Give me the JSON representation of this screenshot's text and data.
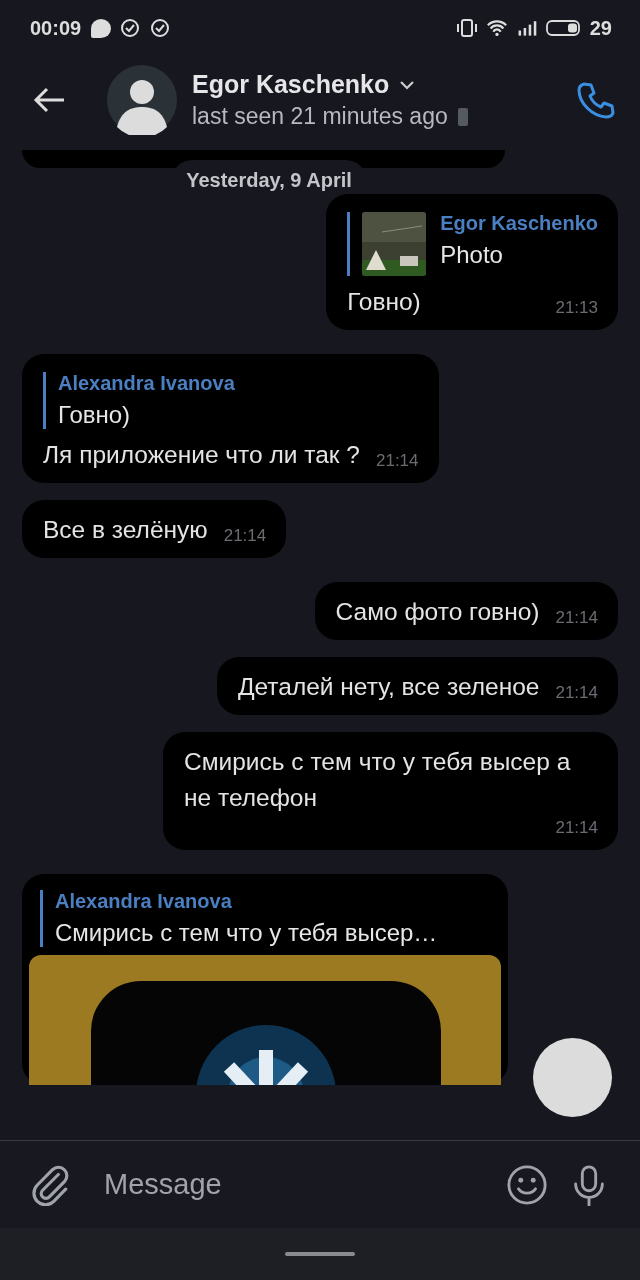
{
  "status_bar": {
    "time": "00:09",
    "battery": "29"
  },
  "header": {
    "name": "Egor Kaschenko",
    "status": "last seen 21 minutes ago"
  },
  "date_chip": "Yesterday, 9 April",
  "messages": [
    {
      "kind": "out",
      "reply": {
        "author": "Egor Kaschenko",
        "text": "Photo",
        "thumbnail": true
      },
      "text": "Говно)",
      "time": "21:13"
    },
    {
      "kind": "in",
      "reply": {
        "author": "Alexandra Ivanova",
        "text": "Говно)",
        "thumbnail": false
      },
      "text": "Ля приложение что ли так ?",
      "time": "21:14"
    },
    {
      "kind": "in",
      "text": "Все в зелёную",
      "time": "21:14"
    },
    {
      "kind": "out",
      "text": "Само фото говно)",
      "time": "21:14"
    },
    {
      "kind": "out",
      "text": "Деталей нету, все зеленое",
      "time": "21:14"
    },
    {
      "kind": "out",
      "text": "Смирись с тем что у тебя высер а не телефон",
      "time": "21:14"
    },
    {
      "kind": "in",
      "reply": {
        "author": "Alexandra Ivanova",
        "text": "Смирись с тем что у тебя высер…",
        "thumbnail": false
      },
      "photo": true
    }
  ],
  "composer": {
    "placeholder": "Message"
  }
}
